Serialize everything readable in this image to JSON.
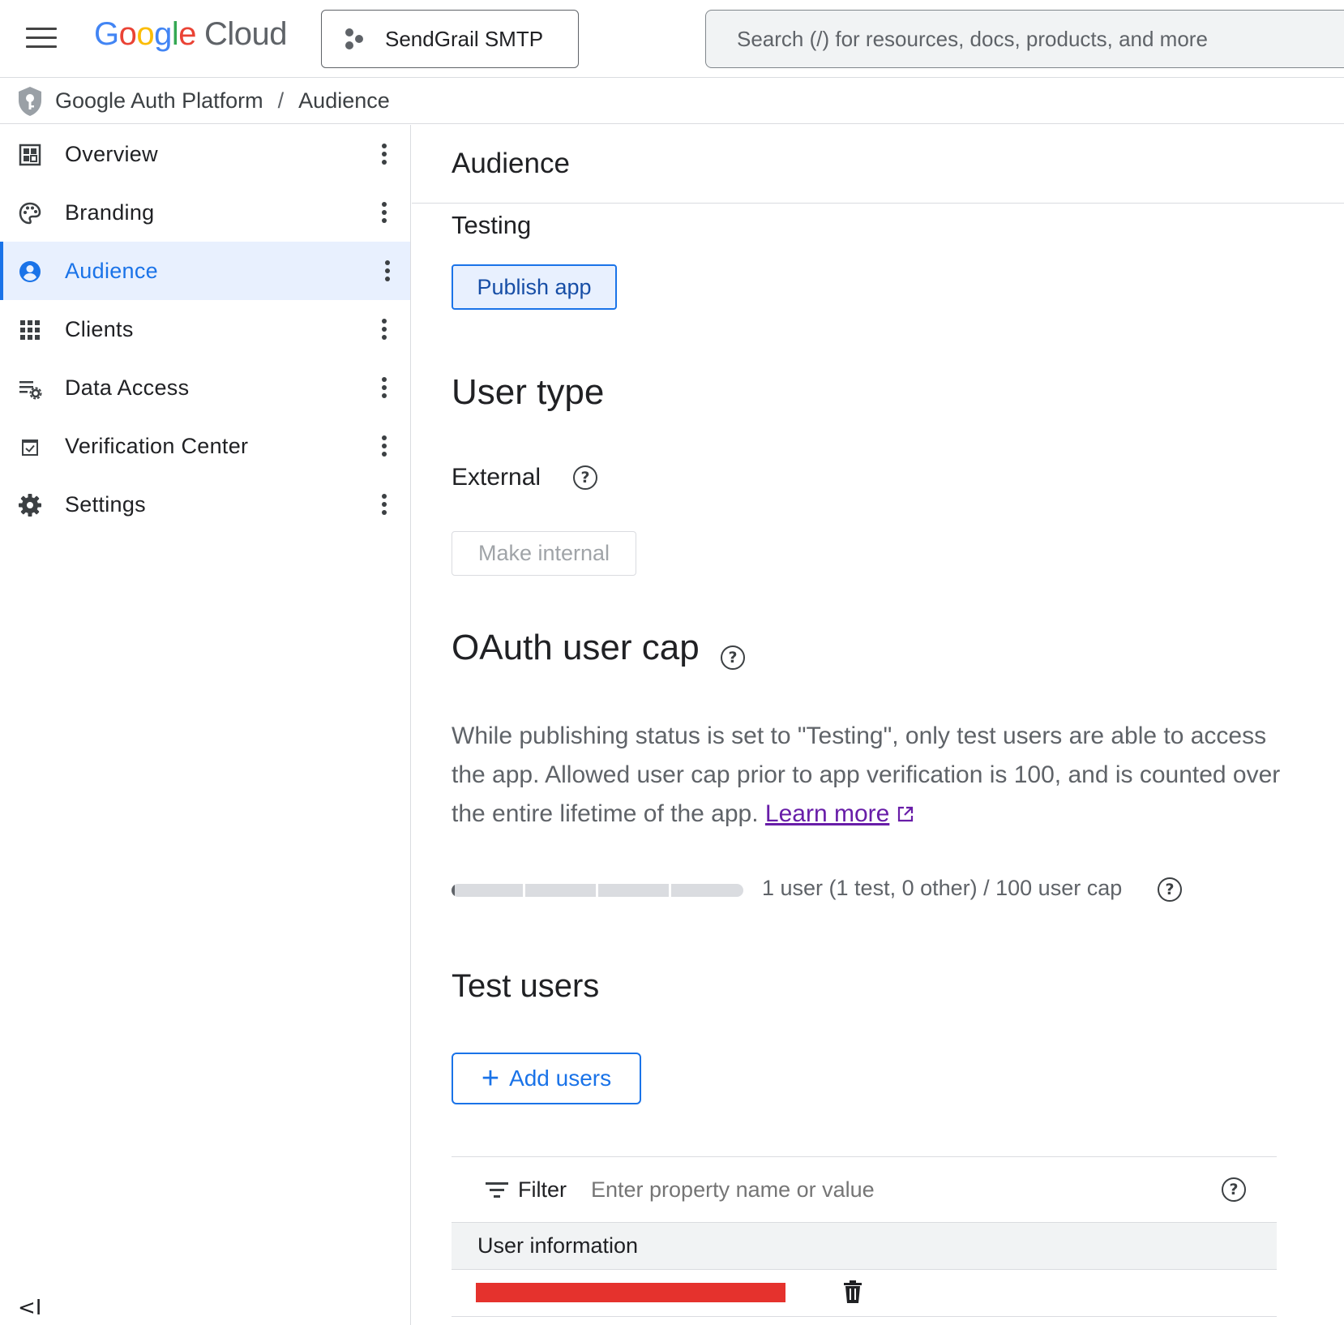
{
  "topbar": {
    "logo_letters": [
      "G",
      "o",
      "o",
      "g",
      "l",
      "e"
    ],
    "logo_suffix": "Cloud",
    "project_name": "SendGrail SMTP",
    "search_placeholder": "Search (/) for resources, docs, products, and more"
  },
  "breadcrumb": {
    "root": "Google Auth Platform",
    "separator": "/",
    "current": "Audience"
  },
  "sidebar": {
    "items": [
      {
        "label": "Overview",
        "icon": "dashboard-icon",
        "active": false
      },
      {
        "label": "Branding",
        "icon": "palette-icon",
        "active": false
      },
      {
        "label": "Audience",
        "icon": "account-circle-icon",
        "active": true
      },
      {
        "label": "Clients",
        "icon": "apps-grid-icon",
        "active": false
      },
      {
        "label": "Data Access",
        "icon": "list-settings-icon",
        "active": false
      },
      {
        "label": "Verification Center",
        "icon": "checkbox-icon",
        "active": false
      },
      {
        "label": "Settings",
        "icon": "gear-icon",
        "active": false
      }
    ],
    "collapse_label": "<I"
  },
  "main": {
    "title": "Audience",
    "publishing_status": "Testing",
    "publish_button": "Publish app",
    "user_type_heading": "User type",
    "user_type_value": "External",
    "make_internal_button": "Make internal",
    "cap_heading": "OAuth user cap",
    "cap_description": "While publishing status is set to \"Testing\", only test users are able to access the app. Allowed user cap prior to app verification is 100, and is counted over the entire lifetime of the app.",
    "learn_more": "Learn more",
    "cap_usage_fraction": 0.01,
    "cap_count_text": "1 user (1 test, 0 other) / 100 user cap",
    "test_users_heading": "Test users",
    "add_users_button": "Add users",
    "filter_label": "Filter",
    "filter_placeholder": "Enter property name or value",
    "table_header": "User information"
  },
  "colors": {
    "accent": "#1a73e8",
    "active_bg": "#e8f0fe",
    "link_visited": "#681da8",
    "redaction": "#e5322d"
  }
}
